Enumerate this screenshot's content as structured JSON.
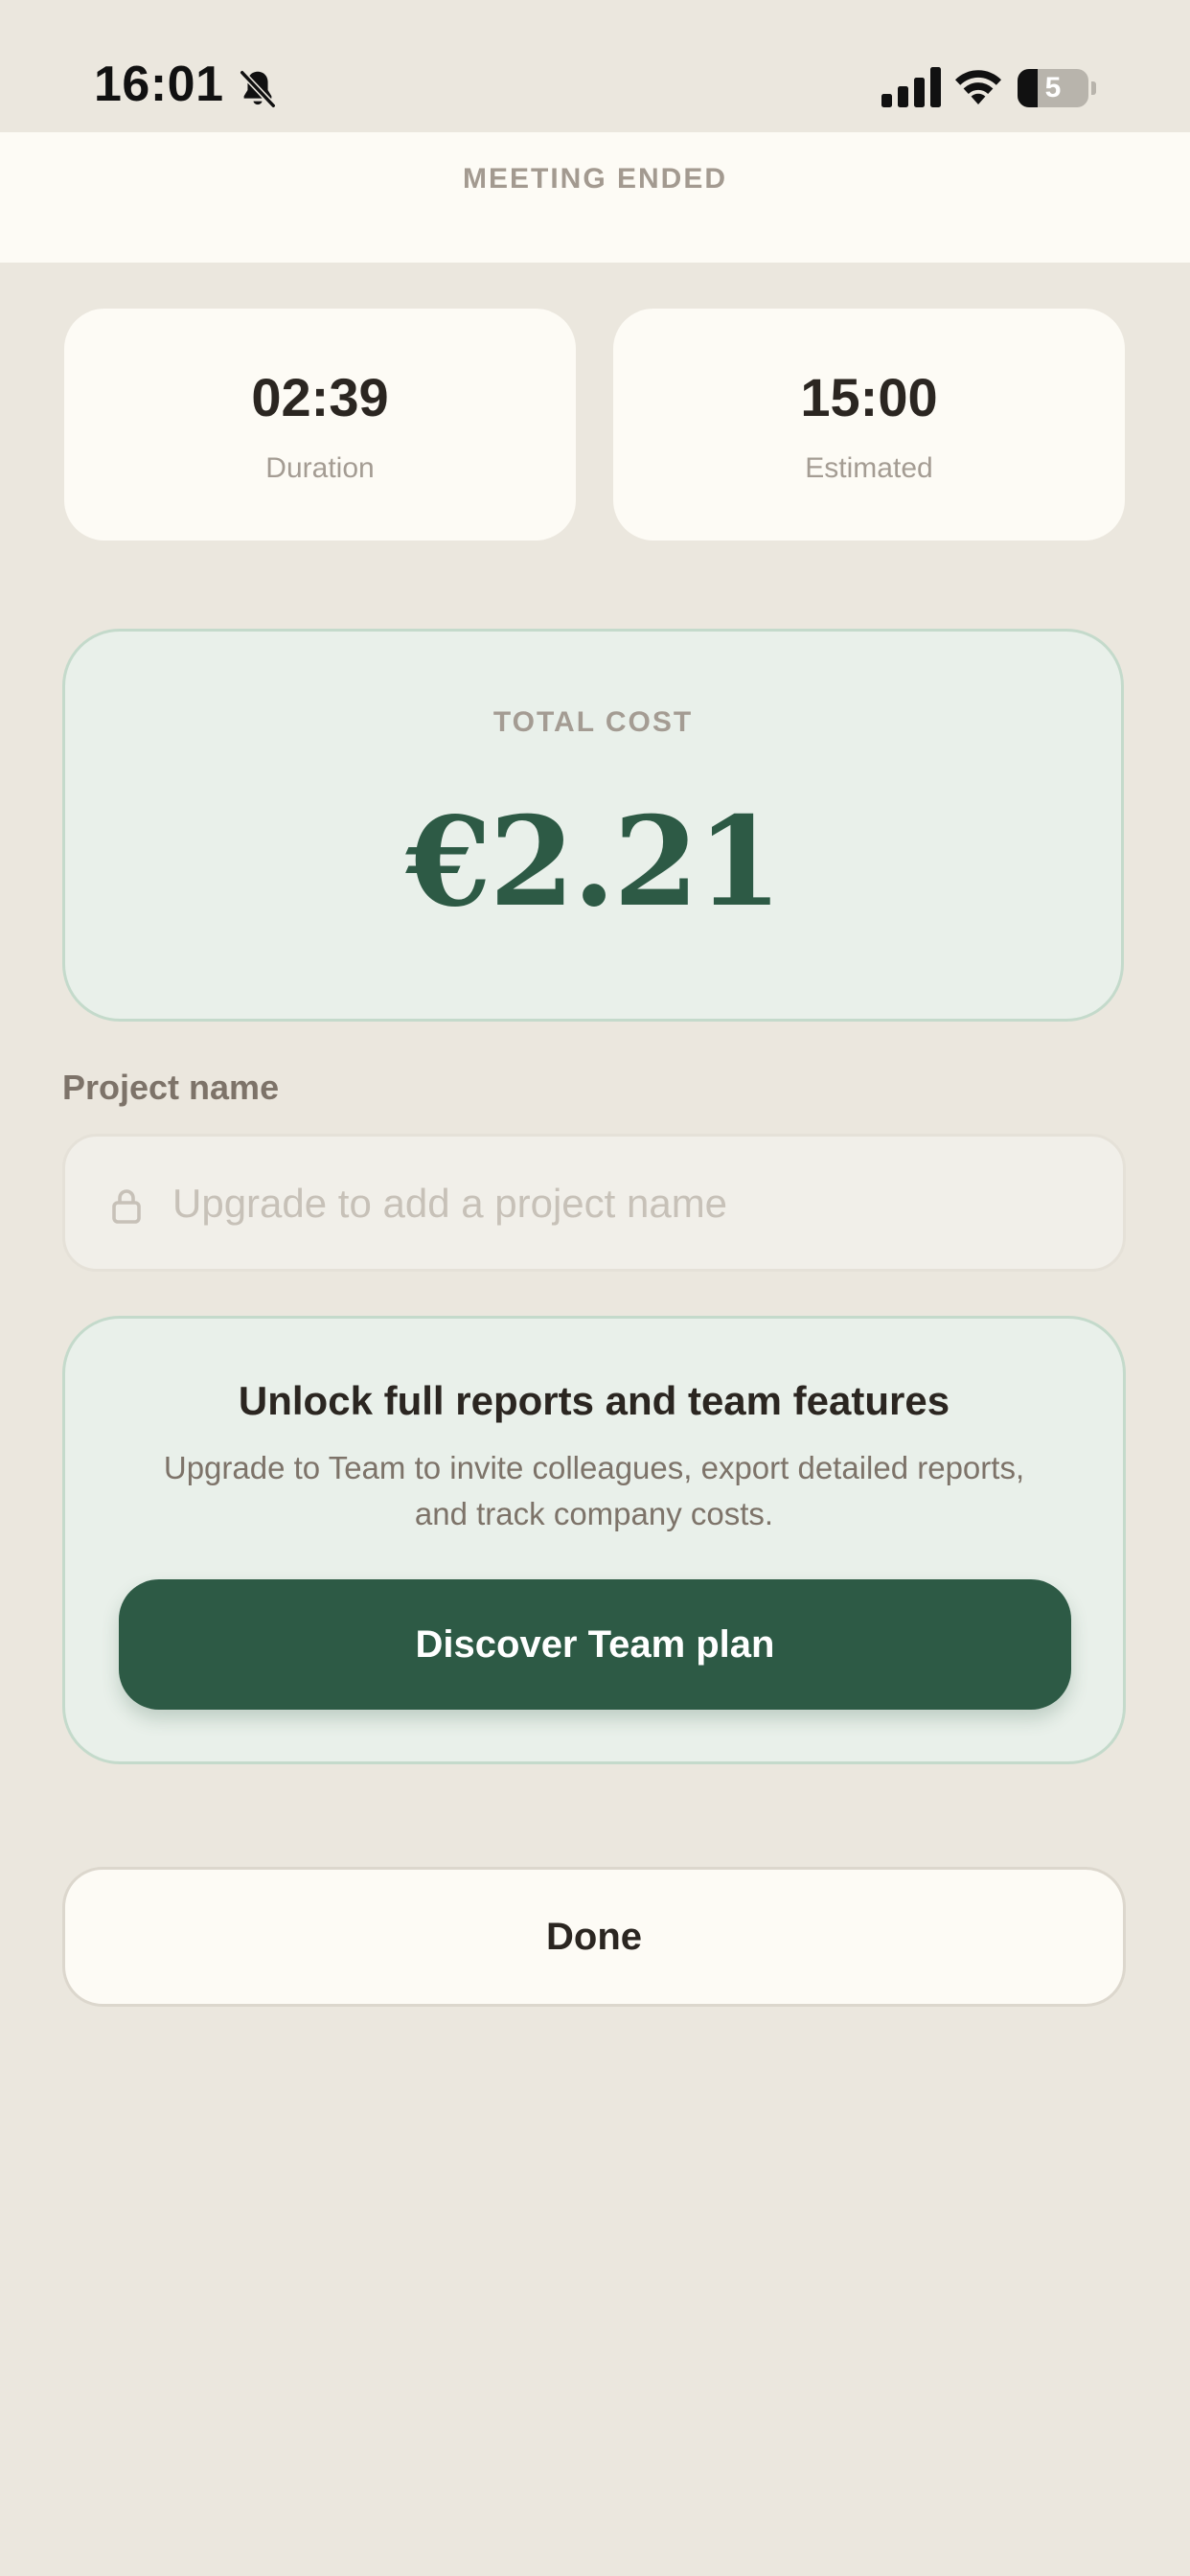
{
  "status_bar": {
    "time": "16:01",
    "battery_percent": "5",
    "battery_level": 0.05,
    "icons": [
      "bell-slash-icon",
      "cellular-signal-icon",
      "wifi-icon",
      "battery-icon"
    ]
  },
  "header": {
    "title": "MEETING ENDED"
  },
  "stats": {
    "duration": {
      "value": "02:39",
      "label": "Duration"
    },
    "estimated": {
      "value": "15:00",
      "label": "Estimated"
    }
  },
  "total": {
    "label": "TOTAL COST",
    "value": "€2.21"
  },
  "project": {
    "label": "Project name",
    "placeholder": "Upgrade to add a project name",
    "icon": "lock-icon"
  },
  "upgrade": {
    "title": "Unlock full reports and team features",
    "description": "Upgrade to Team to invite colleagues, export detailed reports, and track company costs.",
    "button_label": "Discover Team plan"
  },
  "done": {
    "label": "Done"
  },
  "colors": {
    "background": "#ebe7de",
    "card": "#fdfbf5",
    "accent_green": "#2d5a45",
    "mint_panel": "#e9f0ea",
    "muted_text": "#a49c93"
  }
}
